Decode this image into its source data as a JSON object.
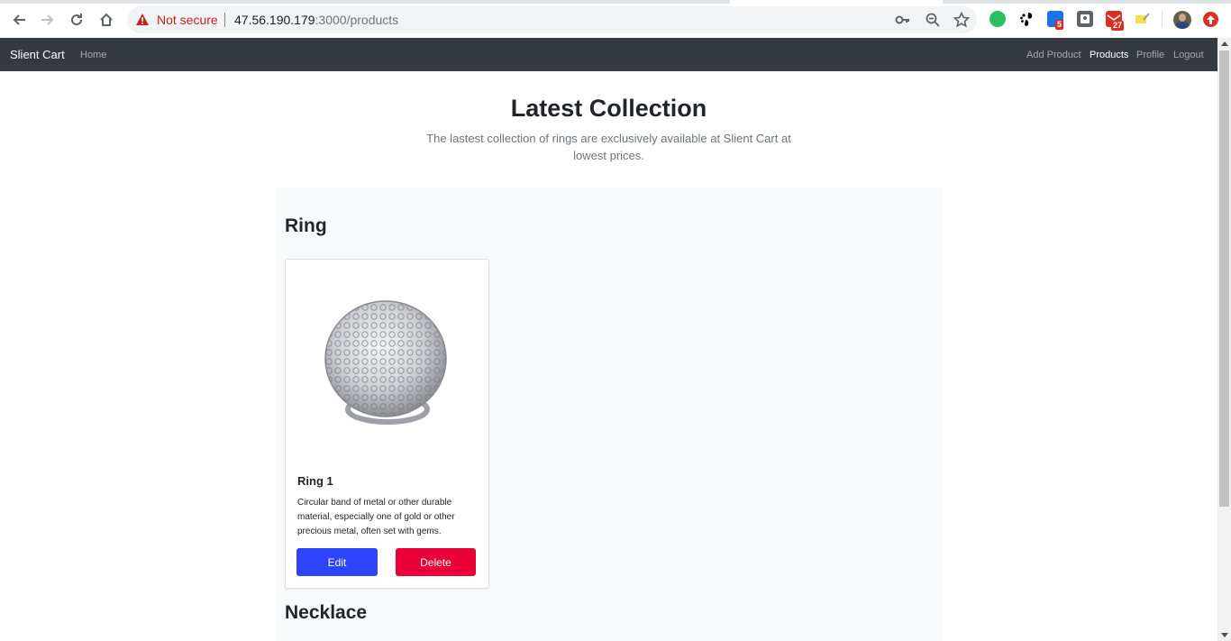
{
  "browser": {
    "security_label": "Not secure",
    "url_host": "47.56.190.179",
    "url_rest": ":3000/products",
    "extensions": [
      {
        "name": "evernote-icon",
        "color": "#2dbe60"
      },
      {
        "name": "gnome-icon",
        "color": "#000000"
      },
      {
        "name": "tasks-icon",
        "color": "#1a73e8",
        "badge": "5"
      },
      {
        "name": "pocket-icon",
        "color": "#5f6368"
      },
      {
        "name": "gmail-icon",
        "color": "#d93025",
        "badge": "27"
      },
      {
        "name": "highlighter-icon",
        "color": "#f6e04b"
      }
    ]
  },
  "navbar": {
    "brand": "Slient Cart",
    "home": "Home",
    "add_product": "Add Product",
    "products": "Products",
    "profile": "Profile",
    "logout": "Logout"
  },
  "hero": {
    "title": "Latest Collection",
    "subtitle": "The lastest collection of rings are exclusively available at Slient Cart at lowest prices."
  },
  "sections": [
    {
      "title": "Ring",
      "products": [
        {
          "name": "Ring 1",
          "description": "Circular band of metal or other durable material, especially one of gold or other precious metal, often set with gems.",
          "edit_label": "Edit",
          "delete_label": "Delete"
        }
      ]
    },
    {
      "title": "Necklace",
      "products": []
    }
  ],
  "colors": {
    "navbar_bg": "#343a40",
    "edit_button": "#2d44fb",
    "delete_button": "#ea0038",
    "collection_bg": "#f8f9fa"
  }
}
